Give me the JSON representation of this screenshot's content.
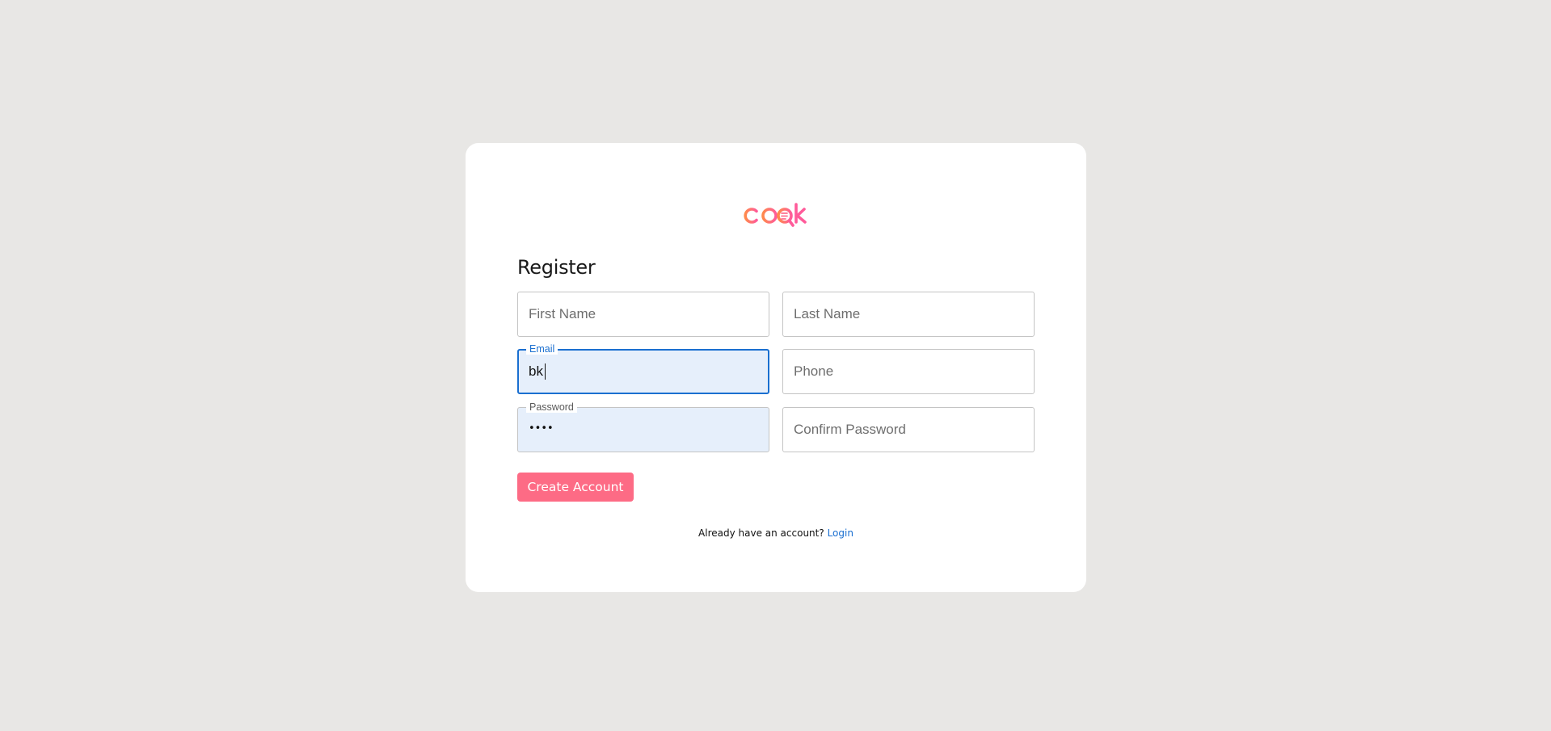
{
  "brand": {
    "logo_text": "cook",
    "colors": {
      "gradient_start": "#ff8a4c",
      "gradient_end": "#ff5b9a"
    }
  },
  "form": {
    "title": "Register",
    "first_name": {
      "placeholder": "First Name",
      "value": ""
    },
    "last_name": {
      "placeholder": "Last Name",
      "value": ""
    },
    "email": {
      "label": "Email",
      "value": "bk"
    },
    "phone": {
      "placeholder": "Phone",
      "value": ""
    },
    "password": {
      "label": "Password",
      "masked_value": "••••"
    },
    "confirm_password": {
      "placeholder": "Confirm Password",
      "value": ""
    },
    "submit_label": "Create Account"
  },
  "footer": {
    "prompt": "Already have an account?",
    "login_label": "Login"
  },
  "colors": {
    "background": "#e8e7e5",
    "accent": "#fd6b85",
    "focus": "#1a6fd0",
    "autofill": "#e6effb"
  }
}
